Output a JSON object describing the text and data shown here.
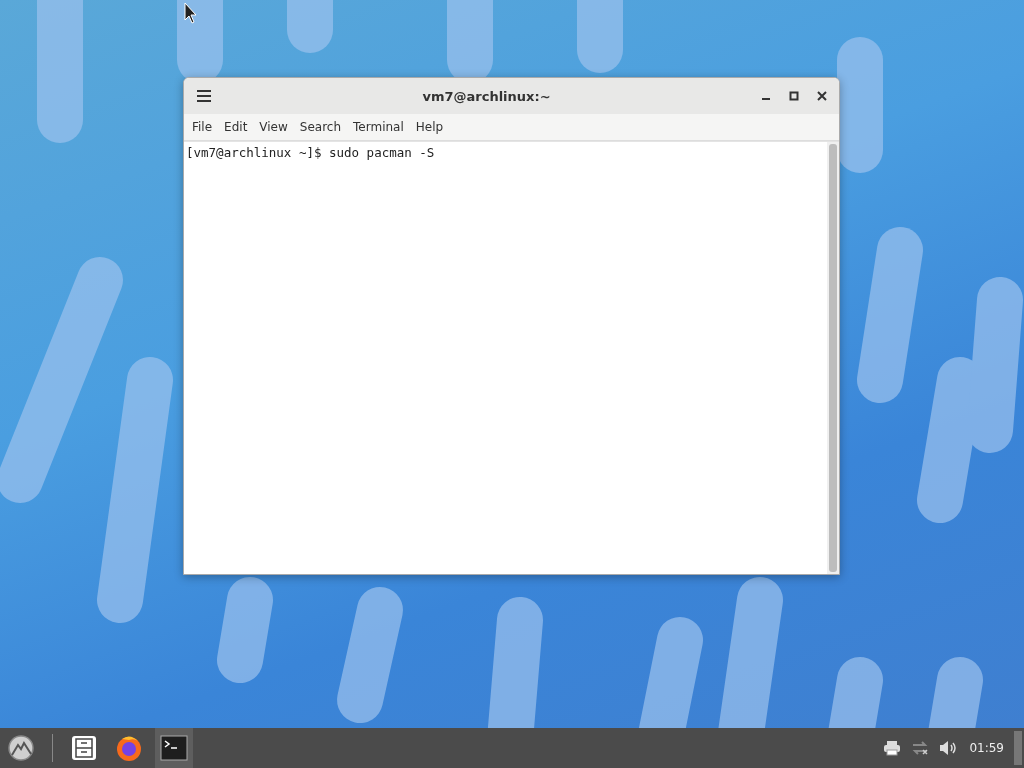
{
  "window": {
    "title": "vm7@archlinux:~"
  },
  "menu": [
    {
      "label": "File"
    },
    {
      "label": "Edit"
    },
    {
      "label": "View"
    },
    {
      "label": "Search"
    },
    {
      "label": "Terminal"
    },
    {
      "label": "Help"
    }
  ],
  "terminal": {
    "lines": [
      "[vm7@archlinux ~]$ sudo pacman -S"
    ]
  },
  "taskbar": {
    "launchers": [
      {
        "kind": "files",
        "selected": false
      },
      {
        "kind": "browser",
        "selected": false
      },
      {
        "kind": "terminal",
        "selected": true
      }
    ],
    "clock": "01:59"
  }
}
